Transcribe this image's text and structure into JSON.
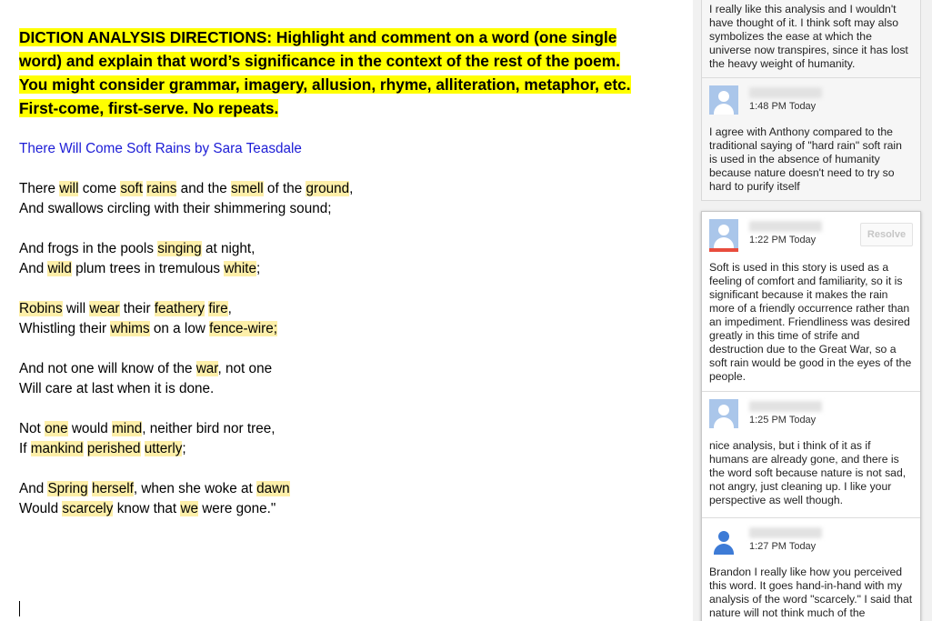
{
  "document": {
    "directions": "DICTION ANALYSIS DIRECTIONS: Highlight and comment on a word (one single word) and explain that word’s significance in the context of the rest of the poem. You might consider grammar, imagery, allusion, rhyme, alliteration, metaphor, etc. First-come, first-serve. No repeats.",
    "title": "There Will Come Soft Rains by Sara Teasdale",
    "stanzas": [
      [
        [
          {
            "t": "There "
          },
          {
            "t": "will",
            "h": true
          },
          {
            "t": " come "
          },
          {
            "t": "soft",
            "h": true
          },
          {
            "t": " "
          },
          {
            "t": "rains",
            "h": true
          },
          {
            "t": " and the "
          },
          {
            "t": "smell",
            "h": true
          },
          {
            "t": " of the "
          },
          {
            "t": "ground",
            "h": true
          },
          {
            "t": ","
          }
        ],
        [
          {
            "t": "And swallows circling with their shimmering sound;"
          }
        ]
      ],
      [
        [
          {
            "t": "And frogs in the pools "
          },
          {
            "t": "singing",
            "h": true
          },
          {
            "t": " at night,"
          }
        ],
        [
          {
            "t": "And "
          },
          {
            "t": "wild",
            "h": true
          },
          {
            "t": " plum trees in tremulous "
          },
          {
            "t": "white",
            "h": true
          },
          {
            "t": ";"
          }
        ]
      ],
      [
        [
          {
            "t": "Robins",
            "h": true
          },
          {
            "t": " will "
          },
          {
            "t": "wear",
            "h": true
          },
          {
            "t": " their "
          },
          {
            "t": "feathery",
            "h": true
          },
          {
            "t": " "
          },
          {
            "t": "fire",
            "h": true
          },
          {
            "t": ","
          }
        ],
        [
          {
            "t": "Whistling their "
          },
          {
            "t": "whims",
            "h": true
          },
          {
            "t": " on a low "
          },
          {
            "t": "fence-wire;",
            "h": true
          }
        ]
      ],
      [
        [
          {
            "t": "And not one will know of the "
          },
          {
            "t": "war",
            "h": true
          },
          {
            "t": ", not one"
          }
        ],
        [
          {
            "t": "Will care at last when it is done."
          }
        ]
      ],
      [
        [
          {
            "t": "Not "
          },
          {
            "t": "one",
            "h": true
          },
          {
            "t": " would "
          },
          {
            "t": "mind",
            "h": true
          },
          {
            "t": ", neither bird nor tree,"
          }
        ],
        [
          {
            "t": "If "
          },
          {
            "t": "mankind",
            "h": true
          },
          {
            "t": " "
          },
          {
            "t": "perished",
            "h": true
          },
          {
            "t": " "
          },
          {
            "t": "utterly",
            "h": true
          },
          {
            "t": ";"
          }
        ]
      ],
      [
        [
          {
            "t": "And "
          },
          {
            "t": "Spring",
            "h": true
          },
          {
            "t": " "
          },
          {
            "t": "herself",
            "h": true
          },
          {
            "t": ", when she woke at "
          },
          {
            "t": "dawn",
            "h": true
          }
        ],
        [
          {
            "t": "Would "
          },
          {
            "t": "scarcely",
            "h": true
          },
          {
            "t": " know that "
          },
          {
            "t": "we",
            "h": true
          },
          {
            "t": " were gone.\""
          }
        ]
      ]
    ],
    "colors": {
      "directions_highlight": "#ffff00",
      "word_highlight": "#fdefa9",
      "title_link": "#1d1dd6"
    }
  },
  "comments": {
    "card1": {
      "top_reply_text": "I really like this analysis and I wouldn't have thought of it. I think soft may also symbolizes the ease at which the universe now transpires, since it has lost the heavy weight of humanity.",
      "reply2": {
        "time": "1:48 PM Today",
        "text": "I agree with Anthony compared to the traditional saying of \"hard rain\" soft rain is used in the absence of humanity because nature doesn't need to try so hard to purify itself"
      }
    },
    "card2": {
      "resolve_label": "Resolve",
      "main": {
        "time": "1:22 PM Today",
        "text": "Soft is used in this story is used as a feeling of comfort and familiarity, so it is significant because it makes the rain more of a friendly occurrence rather than an impediment. Friendliness was desired greatly in this time of strife and destruction due to the Great War, so a soft rain would be good in the eyes of the people."
      },
      "reply1": {
        "time": "1:25 PM Today",
        "text": "nice analysis, but i think of it as if humans are already gone, and there is the word soft because nature is not sad, not angry, just cleaning up. I like your perspective as well though."
      },
      "reply2": {
        "time": "1:27 PM Today",
        "text": "Brandon I really like how you perceived this word. It goes hand-in-hand with my analysis of the word \"scarcely.\" I said that nature will not think much of the perishing of"
      }
    },
    "icons": {
      "avatar": "user-silhouette-icon"
    }
  }
}
